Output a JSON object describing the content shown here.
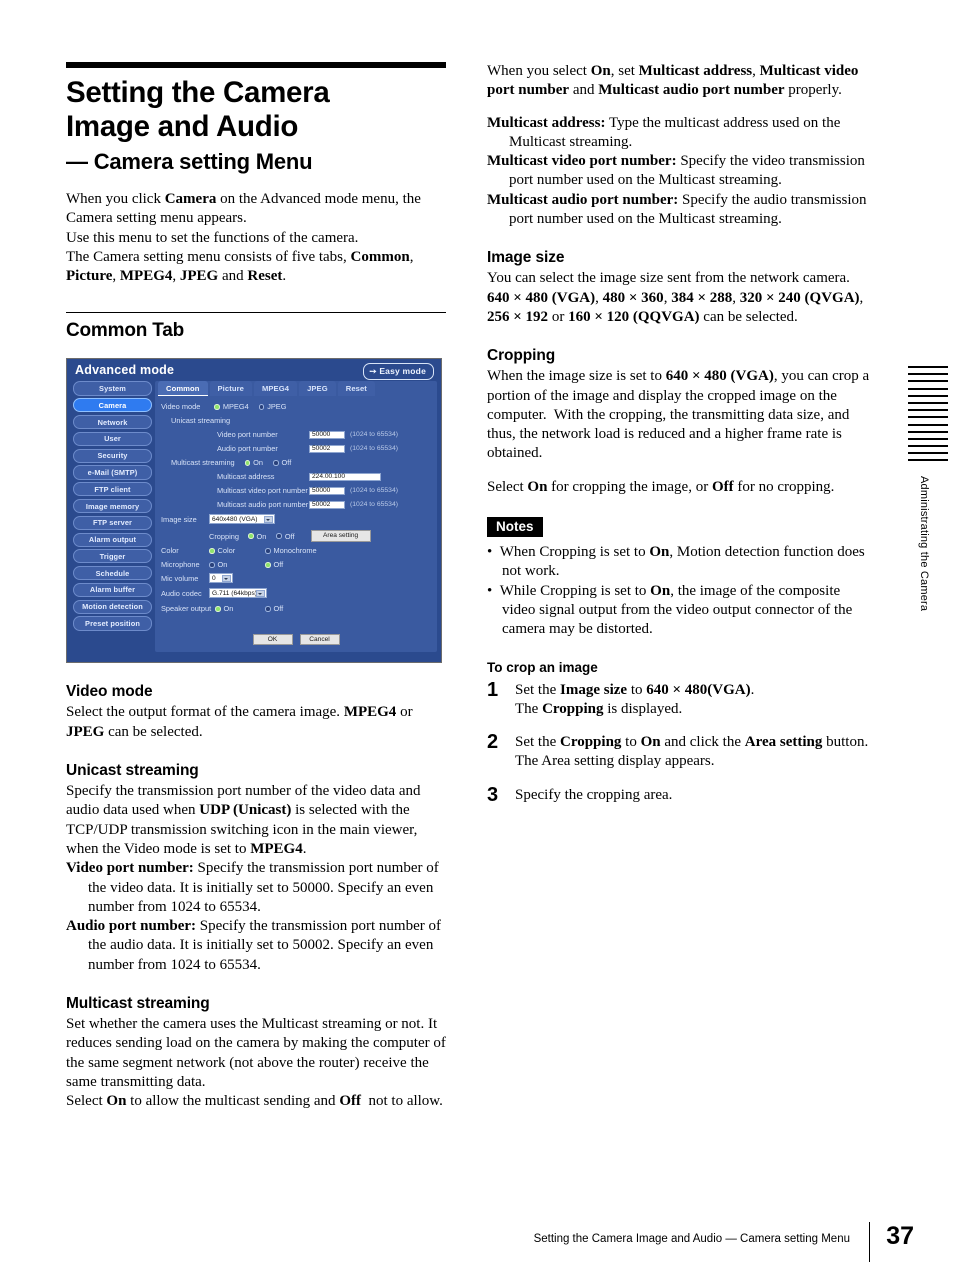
{
  "doc": {
    "chapter_title_line1": "Setting the Camera",
    "chapter_title_line2": "Image and Audio",
    "chapter_subtitle": "— Camera setting Menu",
    "intro": [
      "When you click <b>Camera</b> on the Advanced mode menu, the Camera setting menu appears.",
      "Use this menu to set the functions of the camera.",
      "The Camera setting menu consists of five tabs, <b>Common</b>, <b>Picture</b>, <b>MPEG4</b>, <b>JPEG</b> and <b>Reset</b>."
    ],
    "section_common_tab": "Common Tab"
  },
  "left_column": {
    "video_mode": {
      "heading": "Video mode",
      "body": "Select the output format of the camera image. <b>MPEG4</b> or <b>JPEG</b> can be selected."
    },
    "unicast_streaming": {
      "heading": "Unicast streaming",
      "body": "Specify the transmission port number of the video data and audio data used when <b>UDP (Unicast)</b> is selected with the TCP/UDP transmission switching icon in the main viewer, when the Video mode is set to <b>MPEG4</b>.",
      "video_port": "<b>Video port number:</b> Specify the transmission port number of the video data. It is initially set to 50000. Specify an even number from 1024 to 65534.",
      "audio_port": "<b>Audio port number:</b> Specify the transmission port number of the audio data. It is initially set to 50002. Specify an even number from 1024 to 65534."
    },
    "multicast_streaming": {
      "heading": "Multicast streaming",
      "body": "Set whether the camera uses the Multicast streaming or not. It reduces sending load on the camera by making the computer of the same segment network (not above the router) receive the same transmitting data.",
      "body2": "Select <b>On</b> to allow the multicast sending and <b>Off</b>&nbsp; not to allow."
    }
  },
  "right_column": {
    "multicast_intro": "When you select <b>On</b>, set <b>Multicast address</b>, <b>Multicast video port number</b> and <b>Multicast audio port number</b> properly.",
    "multicast_address": "<b>Multicast address:</b> Type the multicast address used on the Multicast streaming.",
    "multicast_video_port": "<b>Multicast video port number:</b> Specify the video transmission port number used on the Multicast streaming.",
    "multicast_audio_port": "<b>Multicast audio port number:</b> Specify the audio transmission port number used on the Multicast streaming.",
    "image_size": {
      "heading": "Image size",
      "body": "You can select the image size sent from the network camera.",
      "body2": "<b>640 × 480 (VGA)</b>, <b>480 × 360</b>, <b>384 × 288</b>, <b>320 × 240 (QVGA)</b>, <b>256 × 192</b> or <b>160 × 120 (QQVGA)</b> can be selected."
    },
    "cropping": {
      "heading": "Cropping",
      "body": "When the image size is set to <b>640 × 480 (VGA)</b>, you can crop a portion of the image and display the cropped image on the computer.&nbsp; With the cropping, the transmitting data size, and thus, the network load is reduced and a higher frame rate is obtained.",
      "body2": "Select <b>On</b> for cropping the image, or <b>Off</b> for no cropping."
    },
    "notes": {
      "tag": "Notes",
      "items": [
        "When Cropping is set to <b>On</b>, Motion detection function does not work.",
        "While Cropping is set to <b>On</b>, the image of the composite video signal output from the video output connector of the camera may be distorted."
      ]
    },
    "to_crop": {
      "heading": "To crop an image",
      "steps": [
        {
          "num": "1",
          "text": "Set the <b>Image size</b> to <b>640 × 480(VGA)</b>.<br>The <b>Cropping</b> is displayed."
        },
        {
          "num": "2",
          "text": "Set the <b>Cropping</b> to <b>On</b> and click the <b>Area setting</b> button.<br>The Area setting display appears."
        },
        {
          "num": "3",
          "text": "Specify the cropping area."
        }
      ]
    }
  },
  "ui_screenshot": {
    "window_title": "Advanced mode",
    "easy_mode_button": "Easy mode",
    "sidebar": [
      {
        "label": "System",
        "active": false
      },
      {
        "label": "Camera",
        "active": true
      },
      {
        "label": "Network",
        "active": false
      },
      {
        "label": "User",
        "active": false
      },
      {
        "label": "Security",
        "active": false
      },
      {
        "label": "e-Mail (SMTP)",
        "active": false
      },
      {
        "label": "FTP client",
        "active": false
      },
      {
        "label": "Image memory",
        "active": false
      },
      {
        "label": "FTP server",
        "active": false
      },
      {
        "label": "Alarm output",
        "active": false
      },
      {
        "label": "Trigger",
        "active": false
      },
      {
        "label": "Schedule",
        "active": false
      },
      {
        "label": "Alarm buffer",
        "active": false
      },
      {
        "label": "Motion detection",
        "active": false
      },
      {
        "label": "Preset position",
        "active": false
      }
    ],
    "tabs": [
      {
        "label": "Common",
        "selected": true
      },
      {
        "label": "Picture",
        "selected": false
      },
      {
        "label": "MPEG4",
        "selected": false
      },
      {
        "label": "JPEG",
        "selected": false
      },
      {
        "label": "Reset",
        "selected": false
      }
    ],
    "form": {
      "video_mode_label": "Video mode",
      "video_mode_options": [
        "MPEG4",
        "JPEG"
      ],
      "video_mode_value": "MPEG4",
      "unicast_label": "Unicast streaming",
      "video_port_label": "Video port number",
      "video_port_value": "50000",
      "video_port_hint": "(1024 to 65534)",
      "audio_port_label": "Audio port number",
      "audio_port_value": "50002",
      "audio_port_hint": "(1024 to 65534)",
      "multicast_label": "Multicast streaming",
      "multicast_options": [
        "On",
        "Off"
      ],
      "multicast_value": "On",
      "multicast_address_label": "Multicast address",
      "multicast_address_value": "224.00.100",
      "mc_video_port_label": "Multicast video port number",
      "mc_video_port_value": "50000",
      "mc_video_port_hint": "(1024 to 65534)",
      "mc_audio_port_label": "Multicast audio port number",
      "mc_audio_port_value": "50002",
      "mc_audio_port_hint": "(1024 to 65534)",
      "image_size_label": "Image size",
      "image_size_value": "640x480 (VGA)",
      "cropping_label": "Cropping",
      "cropping_options": [
        "On",
        "Off"
      ],
      "cropping_value": "On",
      "area_setting_button": "Area setting",
      "color_label": "Color",
      "color_options": [
        "Color",
        "Monochrome"
      ],
      "color_value": "Color",
      "microphone_label": "Microphone",
      "microphone_options": [
        "On",
        "Off"
      ],
      "microphone_value": "Off",
      "mic_volume_label": "Mic volume",
      "mic_volume_value": "0",
      "audio_codec_label": "Audio codec",
      "audio_codec_value": "G.711 (64kbps)",
      "speaker_output_label": "Speaker output",
      "speaker_output_options": [
        "On",
        "Off"
      ],
      "speaker_output_value": "On",
      "ok_button": "OK",
      "cancel_button": "Cancel"
    }
  },
  "edge_tab": {
    "label": "Administrating the Camera",
    "bar_count": 14
  },
  "footer": {
    "text": "Setting the Camera Image and Audio — Camera setting Menu",
    "page_number": "37"
  }
}
